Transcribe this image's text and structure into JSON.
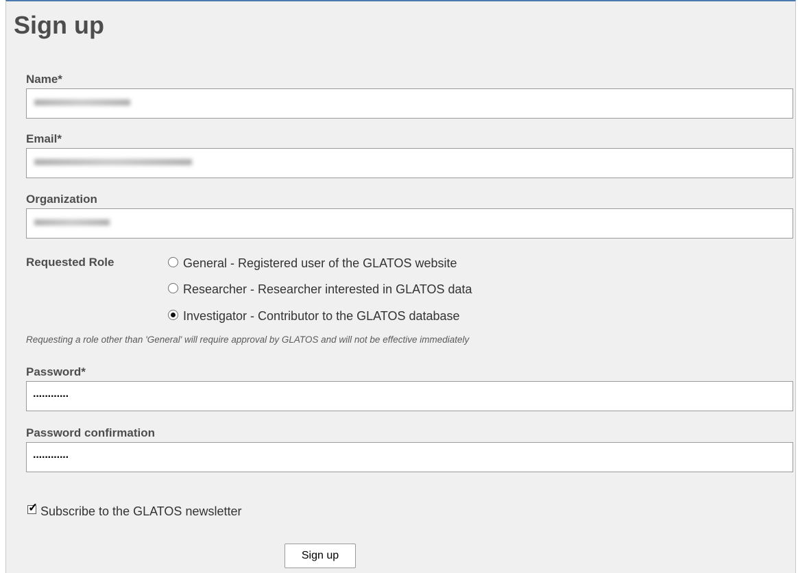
{
  "page": {
    "title": "Sign up"
  },
  "form": {
    "name": {
      "label": "Name*",
      "value": ""
    },
    "email": {
      "label": "Email*",
      "value": ""
    },
    "organization": {
      "label": "Organization",
      "value": ""
    },
    "role": {
      "label": "Requested Role",
      "options": [
        {
          "label": "General - Registered user of the GLATOS website",
          "checked": false
        },
        {
          "label": "Researcher - Researcher interested in GLATOS data",
          "checked": false
        },
        {
          "label": "Investigator - Contributor to the GLATOS database",
          "checked": true
        }
      ],
      "note": "Requesting a role other than 'General' will require approval by GLATOS and will not be effective immediately"
    },
    "password": {
      "label": "Password*",
      "masked_value": "············"
    },
    "password_confirmation": {
      "label": "Password confirmation",
      "masked_value": "············"
    },
    "newsletter": {
      "label": "Subscribe to the GLATOS newsletter",
      "checked": true
    },
    "submit_label": "Sign up"
  },
  "colors": {
    "panel_background": "#f0f0f0",
    "top_border": "#4a7ab0",
    "label_text": "#4d4d4d"
  }
}
